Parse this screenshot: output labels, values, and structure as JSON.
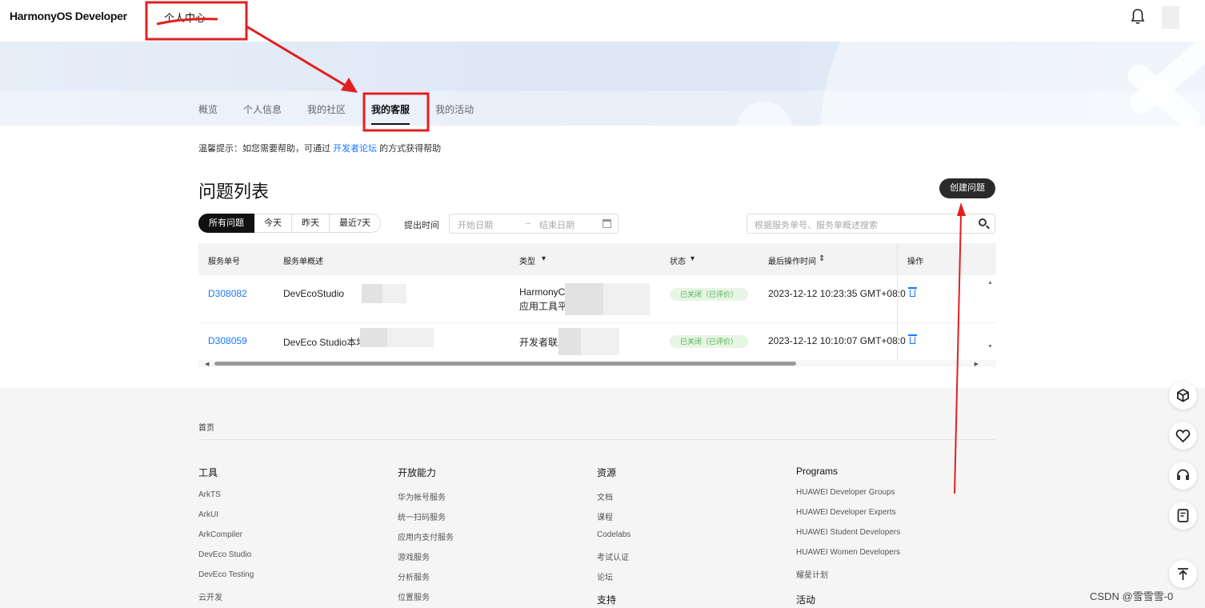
{
  "header": {
    "logo": "HarmonyOS Developer",
    "center_title": "个人中心"
  },
  "tabs": [
    {
      "label": "概览"
    },
    {
      "label": "个人信息"
    },
    {
      "label": "我的社区"
    },
    {
      "label": "我的客服",
      "active": true
    },
    {
      "label": "我的活动"
    }
  ],
  "tip": {
    "prefix": "温馨提示：如您需要帮助，可通过",
    "link": "开发者论坛",
    "suffix": "的方式获得帮助"
  },
  "main": {
    "title": "问题列表",
    "create_button": "创建问题",
    "filters": [
      "所有问题",
      "今天",
      "昨天",
      "最近7天"
    ],
    "active_filter": "所有问题",
    "time_label": "提出时间",
    "date_start_placeholder": "开始日期",
    "date_arrow": "→",
    "date_end_placeholder": "结束日期",
    "search_placeholder": "根据服务单号、服务单概述搜索"
  },
  "table": {
    "headers": {
      "id": "服务单号",
      "summary": "服务单概述",
      "type": "类型",
      "status": "状态",
      "last_op": "最后操作时间",
      "action": "操作"
    },
    "rows": [
      {
        "id": "D308082",
        "summary": "DevEcoStudio",
        "type_line1": "HarmonyC",
        "type_line2": "应用工具平",
        "status": "已关闭（已评价）",
        "time": "2023-12-12 10:23:35 GMT+08:0"
      },
      {
        "id": "D308059",
        "summary": "DevEco Studio本地",
        "type_line1": "开发者联盟",
        "status": "已关闭（已评价）",
        "time": "2023-12-12 10:10:07 GMT+08:0"
      }
    ]
  },
  "footer": {
    "home": "首页",
    "columns": [
      {
        "title": "工具",
        "items": [
          "ArkTS",
          "ArkUI",
          "ArkCompiler",
          "DevEco Studio",
          "DevEco Testing",
          "云开发"
        ]
      },
      {
        "title": "开放能力",
        "items": [
          "华为帐号服务",
          "统一扫码服务",
          "应用内支付服务",
          "游戏服务",
          "分析服务",
          "位置服务"
        ]
      },
      {
        "title": "资源",
        "items": [
          "文档",
          "课程",
          "Codelabs",
          "考试认证",
          "论坛"
        ],
        "next_title": "支持"
      },
      {
        "title": "Programs",
        "items": [
          "HUAWEI Developer Groups",
          "HUAWEI Developer Experts",
          "HUAWEI Student Developers",
          "HUAWEI Women Developers",
          "耀星计划"
        ],
        "next_title": "活动"
      }
    ]
  },
  "watermark": "CSDN @雪雪雪-0",
  "colors": {
    "link": "#1677ff",
    "annotation": "#e02020",
    "dark_button": "#2a2a2a"
  }
}
